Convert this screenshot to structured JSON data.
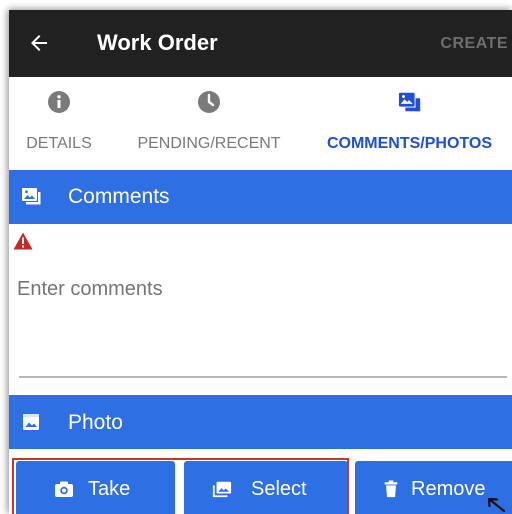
{
  "appbar": {
    "title": "Work Order",
    "action_label": "CREATE",
    "back_icon": "arrow-left-icon"
  },
  "tabs": [
    {
      "label": "DETAILS",
      "icon": "info-icon",
      "active": false
    },
    {
      "label": "PENDING/RECENT",
      "icon": "clock-icon",
      "active": false
    },
    {
      "label": "COMMENTS/PHOTOS",
      "icon": "photos-icon",
      "active": true
    }
  ],
  "comments": {
    "header_label": "Comments",
    "header_icon": "image-icon",
    "warning_icon": "warning-icon",
    "placeholder": "Enter comments",
    "value": ""
  },
  "photo": {
    "header_label": "Photo",
    "header_icon": "photo-frame-icon",
    "buttons": {
      "take": {
        "label": "Take",
        "icon": "camera-icon"
      },
      "select": {
        "label": "Select",
        "icon": "gallery-icon"
      },
      "remove": {
        "label": "Remove",
        "icon": "trash-icon"
      }
    }
  },
  "colors": {
    "appbar_bg": "#212121",
    "accent_blue": "#2f6fe4",
    "active_tab_text": "#1e4fd6",
    "inactive_tab_text": "#7a7a7a",
    "warning_red": "#c62828",
    "highlight_red": "#c0392b"
  }
}
